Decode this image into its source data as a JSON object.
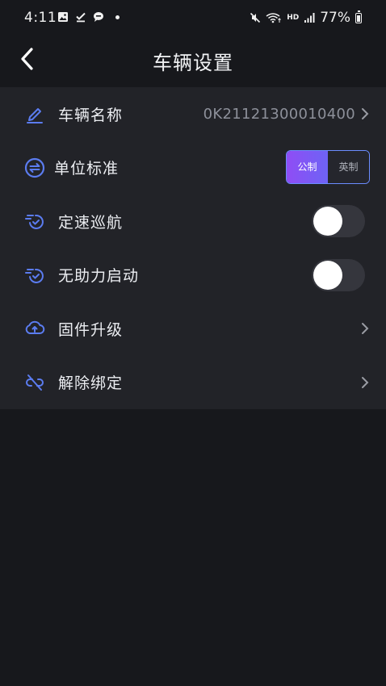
{
  "status_bar": {
    "time": "4:11",
    "hd": "HD",
    "battery_percent": "77%"
  },
  "header": {
    "title": "车辆设置"
  },
  "settings": {
    "vehicle_name": {
      "label": "车辆名称",
      "value": "0K21121300010400"
    },
    "unit_standard": {
      "label": "单位标准",
      "options": [
        "公制",
        "英制"
      ],
      "selected": "公制"
    },
    "cruise_control": {
      "label": "定速巡航",
      "enabled": false
    },
    "no_assist_start": {
      "label": "无助力启动",
      "enabled": false
    },
    "firmware_upgrade": {
      "label": "固件升级"
    },
    "unbind": {
      "label": "解除绑定"
    }
  },
  "colors": {
    "accent": "#5b7cf0",
    "segment_gradient_start": "#8f4df5",
    "segment_gradient_end": "#6e63f5",
    "background": "#17181c",
    "panel": "#222328"
  }
}
